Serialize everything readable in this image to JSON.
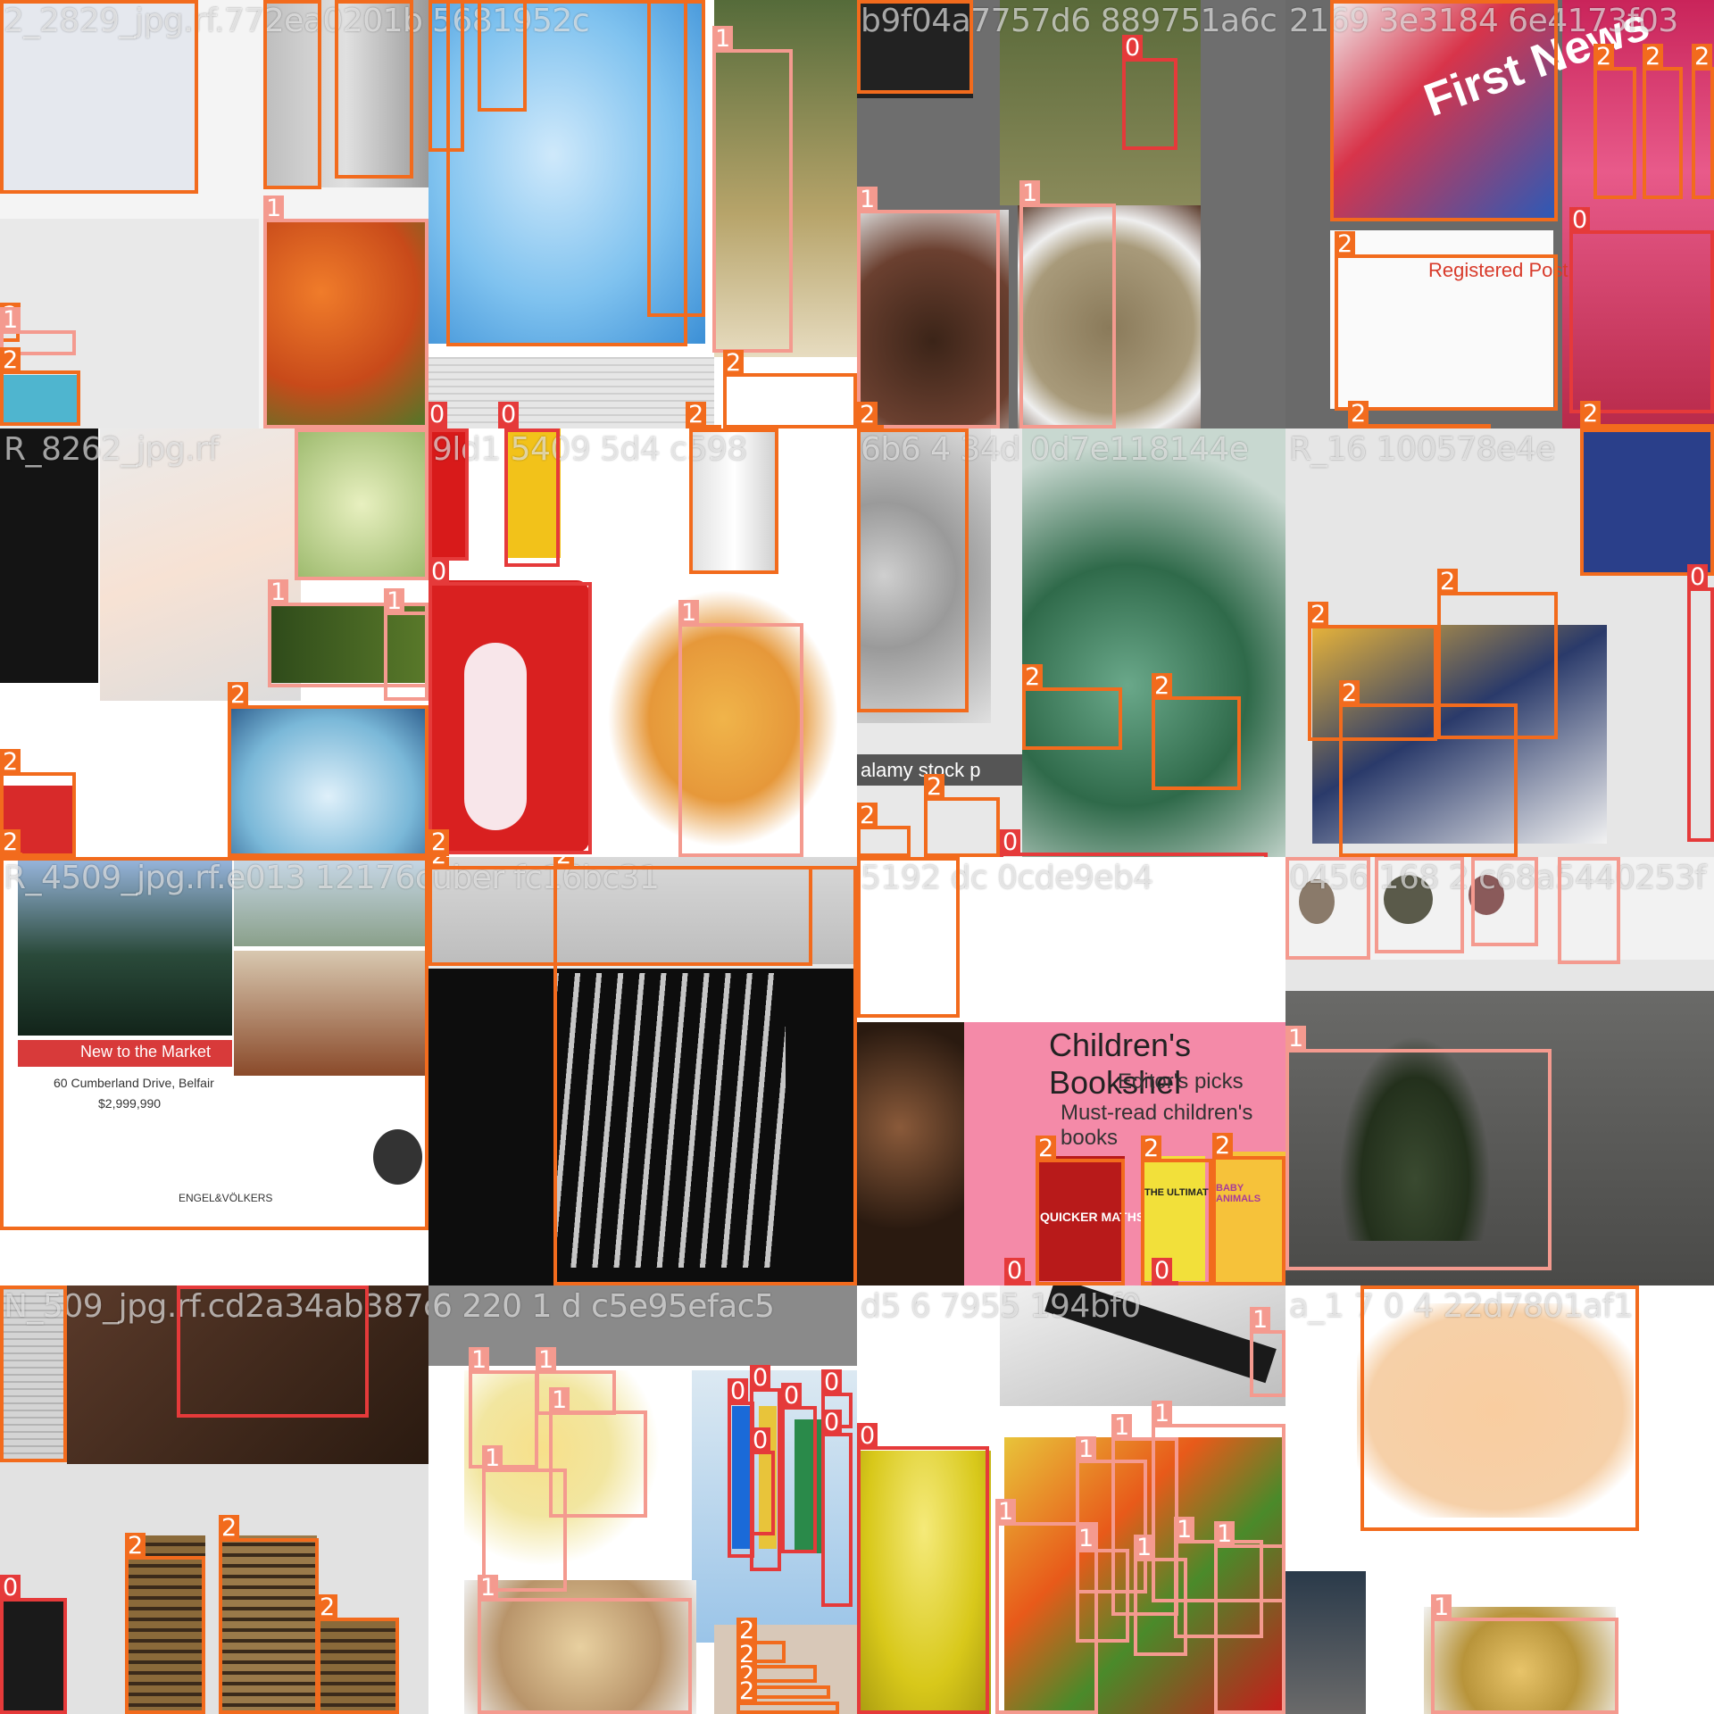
{
  "image": {
    "kind": "object-detection training mosaic",
    "grid": "4x4",
    "class_colors": {
      "0": "#e53a3a",
      "1": "#f49a8f",
      "2": "#f26b1d"
    },
    "tiles": [
      {
        "id": "t00",
        "title": "2_2829_jpg.rf.772ea0201b...",
        "scene": "crumpled paper, steel cans, oranges and vegetables",
        "palette": [
          "#eceff3",
          "#c8c8c8",
          "#e0572b"
        ]
      },
      {
        "id": "t01",
        "title": "...5681952c...",
        "scene": "crushed plastic water bottle, newspaper, blurred field",
        "palette": [
          "#7fc2ef",
          "#ffffff",
          "#6b6a4a"
        ]
      },
      {
        "id": "t02",
        "title": "...b9f04a7757d6...889751a6c...",
        "scene": "coffee grounds and sunflower seeds in bowls, grass",
        "palette": [
          "#4a2b1c",
          "#8a7a5a",
          "#6e7a4a"
        ]
      },
      {
        "id": "t03",
        "title": "...2169...3e3184...6e4173f03",
        "scene": "magazines, parcel post label, felt-tip pens, children's books",
        "palette": [
          "#d8344a",
          "#ffffff",
          "#b52a5a"
        ]
      },
      {
        "id": "t10",
        "title": "R_8262_jpg.rf...",
        "scene": "hand writing on paper, lettuce, zucchini, water bottle",
        "palette": [
          "#1a1a1a",
          "#f1f1f1",
          "#3f6a2a"
        ]
      },
      {
        "id": "t11",
        "title": "...9ld1...5409...5d4...c598...",
        "scene": "mini fridge with polar bear, penne pasta, medicine tube",
        "palette": [
          "#d92020",
          "#ffffff",
          "#e8a43a"
        ]
      },
      {
        "id": "t12",
        "title": "...6b6...4...34d...0d7e118144e...",
        "scene": "pile of plastic bottles, stainless pan",
        "palette": [
          "#2f6a4a",
          "#b8c8c0",
          "#e6e6e6"
        ]
      },
      {
        "id": "t13",
        "title": "R_16...100578e4e",
        "scene": "printed flyers and business brochures, blue bag",
        "palette": [
          "#2a3f8a",
          "#eaeaea",
          "#e8b43a"
        ]
      },
      {
        "id": "t20",
        "title": "R_4509_jpg.rf.e013...12176c76452...",
        "scene": "real estate listing flyer",
        "palette": [
          "#2a4a3a",
          "#ffffff",
          "#d83a3a"
        ]
      },
      {
        "id": "t21",
        "title": "...uber...fc16bc31...",
        "scene": "shredded paper strips on black",
        "palette": [
          "#0d0d0d",
          "#e8e8e8",
          "#bdbdbd"
        ]
      },
      {
        "id": "t22",
        "title": "...5192...dc...0cde9eb4...",
        "scene": "children's bookshelf graphic with book covers, frying pan",
        "palette": [
          "#f48aa8",
          "#ffffff",
          "#4a2a1a"
        ]
      },
      {
        "id": "t23",
        "title": "...0456...168...2...c68a5440253f...",
        "scene": "potted plant in grey room, small stones",
        "palette": [
          "#5a5a58",
          "#e6e6e6",
          "#3a4a30"
        ]
      },
      {
        "id": "t30",
        "title": "N_509_jpg.rf.cd2a34ab387c...",
        "scene": "newspaper, fork with food scraps, tin cans",
        "palette": [
          "#d4d4d4",
          "#3a2a20",
          "#8a6a3a"
        ]
      },
      {
        "id": "t31",
        "title": "...6...220...1...d...c5e95efac5...",
        "scene": "deviled eggs, bread, colorful packaging",
        "palette": [
          "#f2e6a0",
          "#ffffff",
          "#1a6ad8"
        ]
      },
      {
        "id": "t32",
        "title": "...d5...6...7955...194bf0...",
        "scene": "spatulas, yellow bowl, autumn leaves",
        "palette": [
          "#e6d43a",
          "#ffffff",
          "#e85a1a"
        ]
      },
      {
        "id": "t33",
        "title": "...a_1...7...0...4...22d7801af1...",
        "scene": "peach cardboard pieces, crumpled food wrapper",
        "palette": [
          "#f9cda0",
          "#ffffff",
          "#e8c46a"
        ]
      }
    ]
  },
  "tiles_text": {
    "t00": "2_2829_jpg.rf.772ea0201b",
    "t01": "5681952c",
    "t02": "b9f04a7757d6 889751a6c",
    "t03": "2169 3e3184 6e4173f03",
    "t10": "R_8262_jpg.rf",
    "t11": "9ld1 5409 5d4 c598",
    "t12": "6b6 4 34d 0d7e118144e",
    "t13": "R_16 100578e4e",
    "t20": "R_4509_jpg.rf.e013 12176c76452",
    "t21": "uber fc16bc31",
    "t22": "5192 dc 0cde9eb4",
    "t23": "0456 168 2 c68a5440253f",
    "t30": "N_509_jpg.rf.cd2a34ab387c",
    "t31": "6 220 1 d c5e95efac5",
    "t32": "d5 6 7955 194bf0",
    "t33": "a_1 7 0 4 22d7801af1"
  },
  "poster_text": {
    "bookshelf_title": "Children's Bookshel",
    "bookshelf_sub1": "Editor's picks",
    "bookshelf_sub2": "Must-read children's books",
    "book_maths": "QUICKER MATHS",
    "book_ultimate": "THE ULTIMATE",
    "book_animals": "BABY ANIMALS",
    "listing_banner": "New to the Market",
    "listing_address": "60 Cumberland Drive, Belfair",
    "listing_price": "$2,999,990",
    "listing_brand": "ENGEL&VÖLKERS",
    "post_label": "Registered Post",
    "stock_watermark": "alamy stock p",
    "magazine": "First News"
  },
  "boxes": [
    {
      "tile": "t00",
      "cls": "2"
    },
    {
      "tile": "t00",
      "cls": "2"
    },
    {
      "tile": "t00",
      "cls": "2"
    },
    {
      "tile": "t00",
      "cls": "1"
    },
    {
      "tile": "t00",
      "cls": "2"
    },
    {
      "tile": "t00",
      "cls": "1"
    },
    {
      "tile": "t00",
      "cls": "1"
    },
    {
      "tile": "t00",
      "cls": "2"
    },
    {
      "tile": "t01",
      "cls": "2"
    },
    {
      "tile": "t01",
      "cls": "2"
    },
    {
      "tile": "t01",
      "cls": "2"
    },
    {
      "tile": "t01",
      "cls": "1"
    },
    {
      "tile": "t01",
      "cls": "2"
    },
    {
      "tile": "t01",
      "cls": "2"
    },
    {
      "tile": "t01",
      "cls": "0"
    },
    {
      "tile": "t01",
      "cls": "0"
    },
    {
      "tile": "t01",
      "cls": "2"
    },
    {
      "tile": "t02",
      "cls": "2"
    },
    {
      "tile": "t02",
      "cls": "0"
    },
    {
      "tile": "t02",
      "cls": "1"
    },
    {
      "tile": "t02",
      "cls": "1"
    },
    {
      "tile": "t02",
      "cls": "2"
    },
    {
      "tile": "t03",
      "cls": "2"
    },
    {
      "tile": "t03",
      "cls": "2"
    },
    {
      "tile": "t03",
      "cls": "2"
    },
    {
      "tile": "t03",
      "cls": "2"
    },
    {
      "tile": "t03",
      "cls": "0"
    },
    {
      "tile": "t03",
      "cls": "2"
    },
    {
      "tile": "t03",
      "cls": "2"
    },
    {
      "tile": "t03",
      "cls": "2"
    },
    {
      "tile": "t10",
      "cls": "1"
    },
    {
      "tile": "t10",
      "cls": "1"
    },
    {
      "tile": "t10",
      "cls": "1"
    },
    {
      "tile": "t10",
      "cls": "2"
    },
    {
      "tile": "t10",
      "cls": "2"
    },
    {
      "tile": "t10",
      "cls": "2"
    },
    {
      "tile": "t11",
      "cls": "0"
    },
    {
      "tile": "t11",
      "cls": "0"
    },
    {
      "tile": "t11",
      "cls": "2"
    },
    {
      "tile": "t11",
      "cls": "0"
    },
    {
      "tile": "t11",
      "cls": "1"
    },
    {
      "tile": "t11",
      "cls": "2"
    },
    {
      "tile": "t12",
      "cls": "2"
    },
    {
      "tile": "t12",
      "cls": "2"
    },
    {
      "tile": "t12",
      "cls": "2"
    },
    {
      "tile": "t12",
      "cls": "2"
    },
    {
      "tile": "t12",
      "cls": "0"
    },
    {
      "tile": "t12",
      "cls": "2"
    },
    {
      "tile": "t13",
      "cls": "2"
    },
    {
      "tile": "t13",
      "cls": "2"
    },
    {
      "tile": "t13",
      "cls": "2"
    },
    {
      "tile": "t13",
      "cls": "0"
    },
    {
      "tile": "t13",
      "cls": "1"
    },
    {
      "tile": "t13",
      "cls": "1"
    },
    {
      "tile": "t13",
      "cls": "1"
    },
    {
      "tile": "t13",
      "cls": "1"
    },
    {
      "tile": "t20",
      "cls": "2"
    },
    {
      "tile": "t21",
      "cls": "2"
    },
    {
      "tile": "t21",
      "cls": "2"
    },
    {
      "tile": "t22",
      "cls": "2"
    },
    {
      "tile": "t22",
      "cls": "2"
    },
    {
      "tile": "t22",
      "cls": "2"
    },
    {
      "tile": "t22",
      "cls": "0"
    },
    {
      "tile": "t22",
      "cls": "0"
    },
    {
      "tile": "t22",
      "cls": "2"
    },
    {
      "tile": "t23",
      "cls": "1"
    },
    {
      "tile": "t23",
      "cls": "1"
    },
    {
      "tile": "t23",
      "cls": "1"
    },
    {
      "tile": "t23",
      "cls": "1"
    },
    {
      "tile": "t23",
      "cls": "1"
    },
    {
      "tile": "t30",
      "cls": "2"
    },
    {
      "tile": "t30",
      "cls": "0"
    },
    {
      "tile": "t30",
      "cls": "0"
    },
    {
      "tile": "t30",
      "cls": "2"
    },
    {
      "tile": "t30",
      "cls": "2"
    },
    {
      "tile": "t30",
      "cls": "2"
    },
    {
      "tile": "t31",
      "cls": "1"
    },
    {
      "tile": "t31",
      "cls": "1"
    },
    {
      "tile": "t31",
      "cls": "1"
    },
    {
      "tile": "t31",
      "cls": "1"
    },
    {
      "tile": "t31",
      "cls": "1"
    },
    {
      "tile": "t31",
      "cls": "0"
    },
    {
      "tile": "t31",
      "cls": "0"
    },
    {
      "tile": "t31",
      "cls": "0"
    },
    {
      "tile": "t31",
      "cls": "0"
    },
    {
      "tile": "t31",
      "cls": "0"
    },
    {
      "tile": "t31",
      "cls": "0"
    },
    {
      "tile": "t31",
      "cls": "2"
    },
    {
      "tile": "t31",
      "cls": "2"
    },
    {
      "tile": "t31",
      "cls": "2"
    },
    {
      "tile": "t31",
      "cls": "2"
    },
    {
      "tile": "t32",
      "cls": "0"
    },
    {
      "tile": "t32",
      "cls": "1"
    },
    {
      "tile": "t32",
      "cls": "1"
    },
    {
      "tile": "t32",
      "cls": "1"
    },
    {
      "tile": "t32",
      "cls": "1"
    },
    {
      "tile": "t32",
      "cls": "1"
    },
    {
      "tile": "t32",
      "cls": "1"
    },
    {
      "tile": "t32",
      "cls": "1"
    },
    {
      "tile": "t32",
      "cls": "1"
    },
    {
      "tile": "t32",
      "cls": "1"
    },
    {
      "tile": "t33",
      "cls": "2"
    },
    {
      "tile": "t33",
      "cls": "1"
    }
  ]
}
